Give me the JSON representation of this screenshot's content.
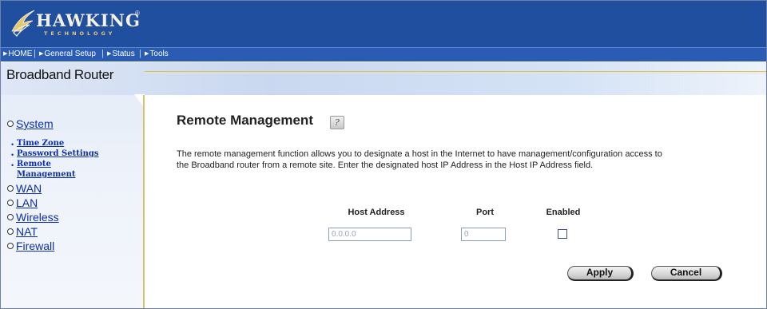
{
  "brand": {
    "name": "HAWKING",
    "registered": "®",
    "subtitle": "TECHNOLOGY"
  },
  "nav": {
    "items": [
      {
        "label": "HOME"
      },
      {
        "label": "General Setup"
      },
      {
        "label": "Status"
      },
      {
        "label": "Tools"
      }
    ],
    "separator": "|"
  },
  "product_title": "Broadband Router",
  "sidebar": {
    "groups": [
      {
        "label": "System",
        "subitems": [
          "Time Zone",
          "Password Settings",
          "Remote",
          "Management"
        ]
      },
      {
        "label": "WAN"
      },
      {
        "label": "LAN"
      },
      {
        "label": "Wireless"
      },
      {
        "label": "NAT"
      },
      {
        "label": "Firewall"
      }
    ],
    "bullet": "•"
  },
  "main": {
    "title": "Remote Management",
    "help_glyph": "?",
    "description_line1": "The remote management function allows you to designate a host in the Internet to have management/configuration access to",
    "description_line2": "the Broadband router from a remote site. Enter the designated host IP Address in the Host IP Address field.",
    "columns": {
      "host_address": "Host Address",
      "port": "Port",
      "enabled": "Enabled"
    },
    "host_address_value": "0.0.0.0",
    "port_value": "0",
    "enabled_checked": false,
    "buttons": {
      "apply": "Apply",
      "cancel": "Cancel"
    }
  },
  "colors": {
    "header": "#1f4f9e",
    "navbar": "#2a5cb3",
    "link": "#0b2fa8",
    "accent_line": "#d9c06d"
  }
}
